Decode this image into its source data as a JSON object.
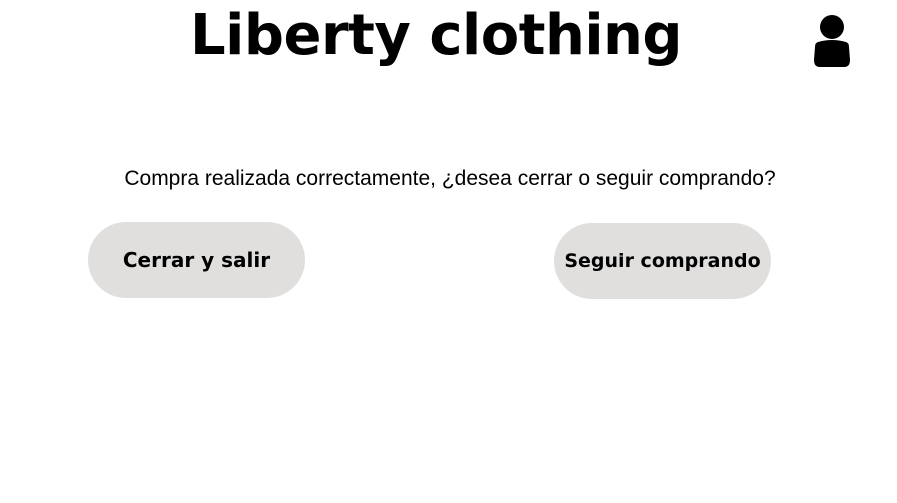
{
  "header": {
    "title": "Liberty clothing",
    "user_icon": "user-icon"
  },
  "main": {
    "message": "Compra realizada correctamente, ¿desea cerrar o seguir comprando?",
    "close_button_label": "Cerrar y salir",
    "continue_button_label": "Seguir comprando"
  },
  "colors": {
    "background": "#ffffff",
    "button_background": "#e0dfde",
    "text": "#000000"
  }
}
